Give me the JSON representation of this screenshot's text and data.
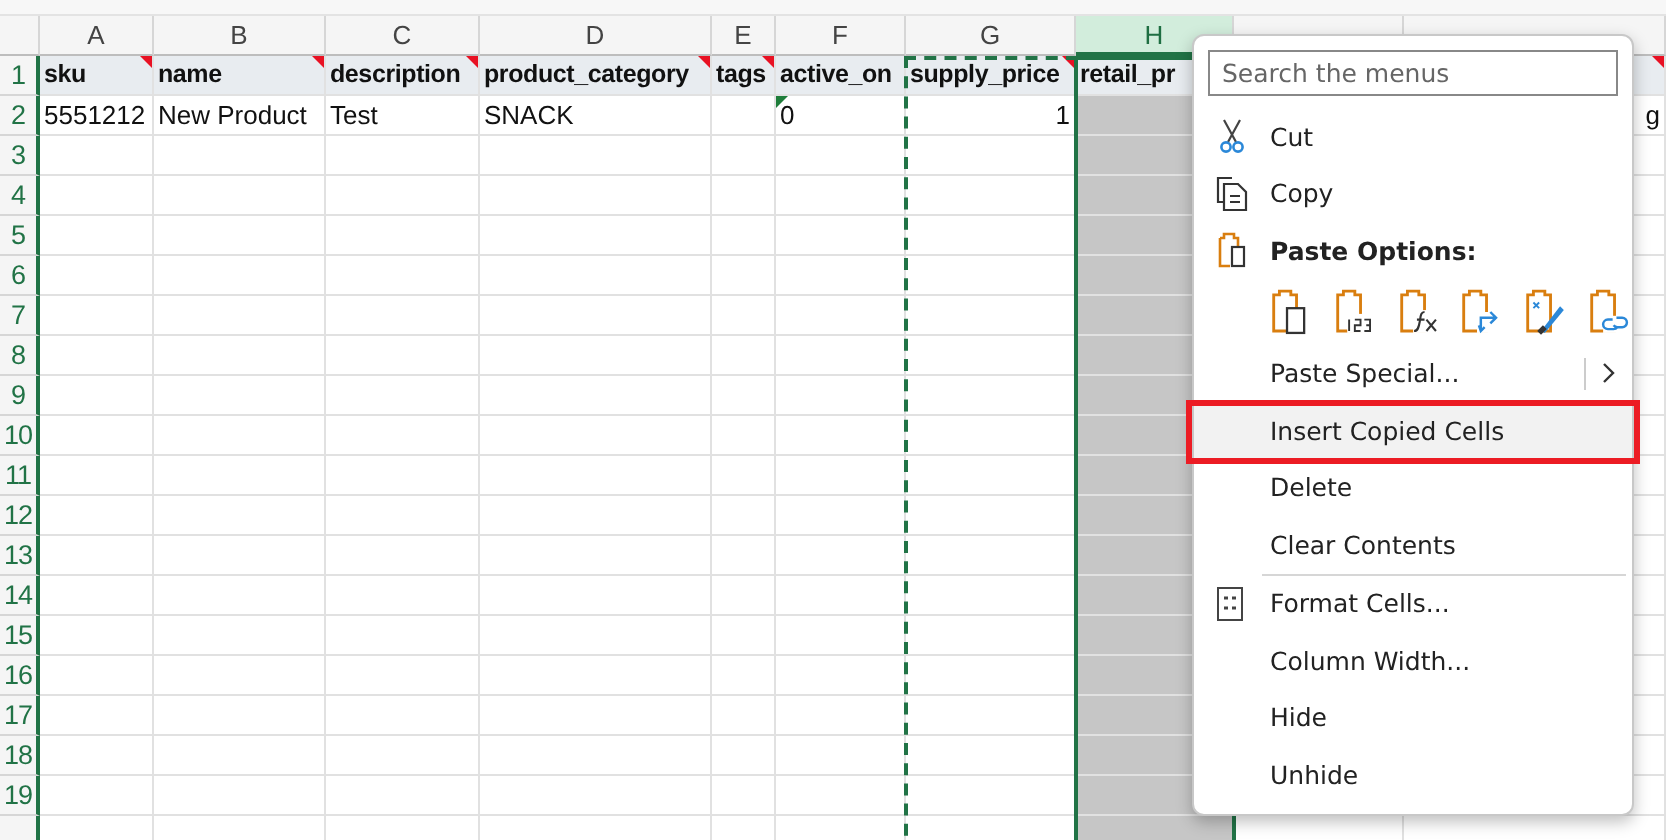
{
  "columns": [
    {
      "letter": "A",
      "selected": false,
      "copied": false
    },
    {
      "letter": "B",
      "selected": false,
      "copied": false
    },
    {
      "letter": "C",
      "selected": false,
      "copied": false
    },
    {
      "letter": "D",
      "selected": false,
      "copied": false
    },
    {
      "letter": "E",
      "selected": false,
      "copied": false
    },
    {
      "letter": "F",
      "selected": false,
      "copied": false
    },
    {
      "letter": "G",
      "selected": false,
      "copied": true
    },
    {
      "letter": "H",
      "selected": true,
      "copied": false
    },
    {},
    {}
  ],
  "rows": [
    {
      "number": "1",
      "kind": "header",
      "cells": [
        {
          "text": "sku",
          "comment": true
        },
        {
          "text": "name",
          "comment": true
        },
        {
          "text": "description",
          "comment": true
        },
        {
          "text": "product_category",
          "comment": true
        },
        {
          "text": "tags",
          "comment": true
        },
        {
          "text": "active_on"
        },
        {
          "text": "supply_price",
          "comment": true
        },
        {
          "text": "retail_pr"
        },
        {},
        {
          "comment": true
        }
      ]
    },
    {
      "number": "2",
      "kind": "data",
      "cells": [
        {
          "text": "5551212",
          "kind": "text"
        },
        {
          "text": "New Product",
          "kind": "text"
        },
        {
          "text": "Test",
          "kind": "text"
        },
        {
          "text": "SNACK",
          "kind": "text"
        },
        {
          "kind": "text"
        },
        {
          "text": "0",
          "kind": "warning"
        },
        {
          "text": "1",
          "kind": "number"
        },
        {
          "kind": "text"
        },
        {
          "kind": "text"
        },
        {
          "text": "g",
          "kind": "number"
        }
      ]
    },
    {
      "number": "3"
    },
    {
      "number": "4"
    },
    {
      "number": "5"
    },
    {
      "number": "6"
    },
    {
      "number": "7"
    },
    {
      "number": "8"
    },
    {
      "number": "9"
    },
    {
      "number": "10"
    },
    {
      "number": "11"
    },
    {
      "number": "12"
    },
    {
      "number": "13"
    },
    {
      "number": "14"
    },
    {
      "number": "15"
    },
    {
      "number": "16"
    },
    {
      "number": "17"
    },
    {
      "number": "18"
    },
    {
      "number": "19"
    },
    {}
  ],
  "context_menu": {
    "search": {
      "placeholder": "Search the menus"
    },
    "items": [
      {
        "kind": "command",
        "label": "Cut",
        "selected": false,
        "marked": false
      },
      {
        "kind": "command",
        "label": "Copy",
        "selected": false,
        "marked": false
      },
      {
        "kind": "heading",
        "label": "Paste Options:"
      },
      {
        "kind": "paste-options"
      },
      {
        "kind": "submenu",
        "label": "Paste Special...",
        "selected": false,
        "marked": false
      },
      {
        "kind": "command",
        "label": "Insert Copied Cells",
        "selected": true,
        "marked": true
      },
      {
        "kind": "command",
        "label": "Delete",
        "selected": false,
        "marked": false
      },
      {
        "kind": "command",
        "label": "Clear Contents",
        "selected": false,
        "marked": false
      },
      {
        "kind": "separator"
      },
      {
        "kind": "command",
        "label": "Format Cells...",
        "selected": false,
        "marked": false
      },
      {
        "kind": "command",
        "label": "Column Width...",
        "selected": false,
        "marked": false
      },
      {
        "kind": "command",
        "label": "Hide",
        "selected": false,
        "marked": false
      },
      {
        "kind": "command",
        "label": "Unhide",
        "selected": false,
        "marked": false
      }
    ]
  }
}
